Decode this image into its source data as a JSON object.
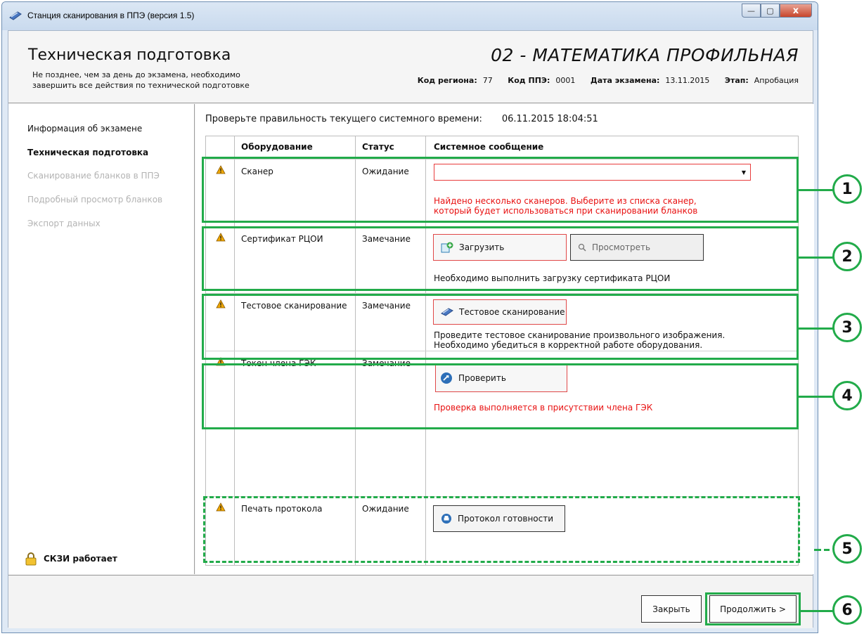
{
  "window": {
    "title": "Станция сканирования в ППЭ (версия 1.5)",
    "controls": {
      "minimize": "—",
      "maximize": "▢",
      "close": "x"
    }
  },
  "header": {
    "title": "Техническая подготовка",
    "subtitle": "Не позднее, чем за день до экзамена, необходимо завершить все действия по технической подготовке",
    "subject": "02 - МАТЕМАТИКА ПРОФИЛЬНАЯ",
    "meta": {
      "region_label": "Код региона:",
      "region_value": "77",
      "ppe_label": "Код ППЭ:",
      "ppe_value": "0001",
      "date_label": "Дата экзамена:",
      "date_value": "13.11.2015",
      "stage_label": "Этап:",
      "stage_value": "Апробация"
    }
  },
  "sidebar": {
    "items": [
      {
        "label": "Информация об экзамене",
        "state": "normal"
      },
      {
        "label": "Техническая подготовка",
        "state": "active"
      },
      {
        "label": "Сканирование бланков в ППЭ",
        "state": "disabled"
      },
      {
        "label": "Подробный просмотр бланков",
        "state": "disabled"
      },
      {
        "label": "Экспорт данных",
        "state": "disabled"
      }
    ],
    "status": "СКЗИ работает"
  },
  "main": {
    "time_label": "Проверьте правильность текущего системного времени:",
    "time_value": "06.11.2015 18:04:51",
    "columns": [
      "Оборудование",
      "Статус",
      "Системное сообщение"
    ],
    "rows": [
      {
        "equipment": "Сканер",
        "status": "Ожидание",
        "combo_value": "",
        "message": "Найдено несколько сканеров. Выберите из списка сканер, который будет использоваться при сканировании бланков"
      },
      {
        "equipment": "Сертификат РЦОИ",
        "status": "Замечание",
        "button_load": "Загрузить",
        "button_view": "Просмотреть",
        "message": "Необходимо выполнить загрузку сертификата РЦОИ"
      },
      {
        "equipment": "Тестовое сканирование",
        "status": "Замечание",
        "button": "Тестовое сканирование",
        "message_line1": "Проведите тестовое сканирование произвольного изображения.",
        "message_line2": "Необходимо убедиться в корректной работе оборудования."
      },
      {
        "equipment": "Токен члена ГЭК",
        "status": "Замечание",
        "button": "Проверить",
        "message": "Проверка выполняется в присутствии члена ГЭК"
      },
      {
        "equipment": "Печать протокола",
        "status": "Ожидание",
        "button": "Протокол готовности"
      }
    ]
  },
  "footer": {
    "close": "Закрыть",
    "continue": "Продолжить >"
  },
  "callouts": [
    "1",
    "2",
    "3",
    "4",
    "5",
    "6"
  ],
  "colors": {
    "annotation": "#22ab4a",
    "error_text": "#e81010",
    "warning": "#f0a800"
  }
}
